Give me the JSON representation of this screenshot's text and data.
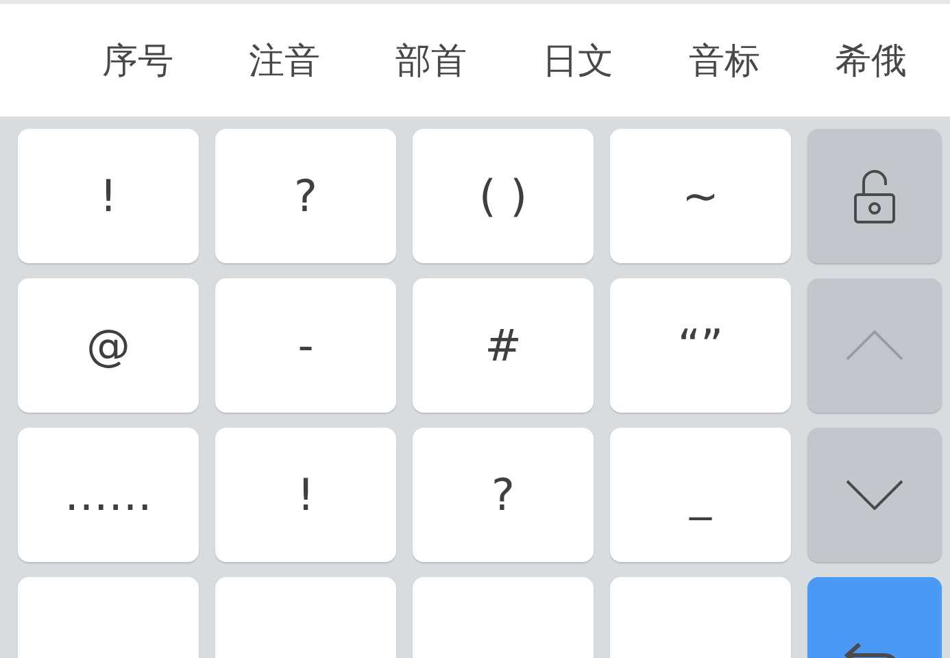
{
  "tabs": [
    {
      "label": "序号",
      "selected": false
    },
    {
      "label": "注音",
      "selected": false
    },
    {
      "label": "部首",
      "selected": false
    },
    {
      "label": "日文",
      "selected": false
    },
    {
      "label": "音标",
      "selected": false
    },
    {
      "label": "希俄",
      "selected": false
    }
  ],
  "keys": [
    [
      {
        "label": "!"
      },
      {
        "label": "?"
      },
      {
        "label": "( )"
      },
      {
        "label": "~"
      }
    ],
    [
      {
        "label": "@"
      },
      {
        "label": "-"
      },
      {
        "label": "#"
      },
      {
        "label": "“”"
      }
    ],
    [
      {
        "label": "……"
      },
      {
        "label": "!"
      },
      {
        "label": "?"
      },
      {
        "label": "_"
      }
    ]
  ],
  "side_keys": [
    {
      "kind": "lock",
      "disabled": false
    },
    {
      "kind": "up",
      "disabled": true
    },
    {
      "kind": "down",
      "disabled": false
    },
    {
      "kind": "enter",
      "disabled": false
    }
  ]
}
